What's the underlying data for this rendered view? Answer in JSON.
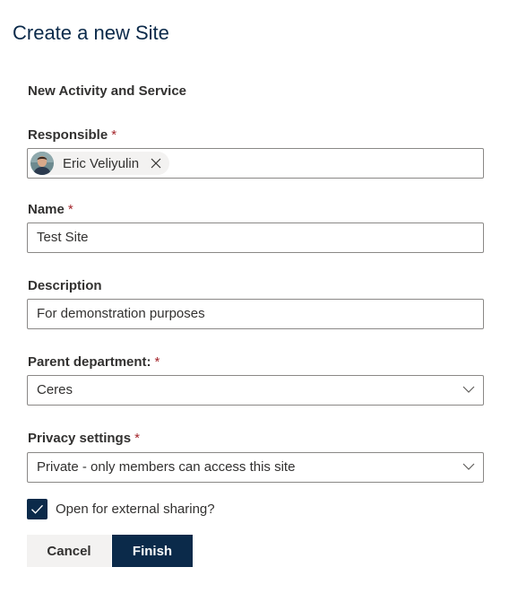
{
  "page": {
    "title": "Create a new Site",
    "section_title": "New Activity and Service"
  },
  "form": {
    "responsible": {
      "label": "Responsible",
      "required_mark": "*",
      "person_name": "Eric Veliyulin"
    },
    "name": {
      "label": "Name",
      "required_mark": "*",
      "value": "Test Site"
    },
    "description": {
      "label": "Description",
      "value": "For demonstration purposes"
    },
    "parent_department": {
      "label": "Parent department:",
      "required_mark": "*",
      "selected": "Ceres"
    },
    "privacy": {
      "label": "Privacy settings",
      "required_mark": "*",
      "selected": "Private - only members can access this site"
    },
    "external_sharing": {
      "label": "Open for external sharing?",
      "checked": true
    }
  },
  "buttons": {
    "cancel": "Cancel",
    "finish": "Finish"
  },
  "colors": {
    "brand": "#0b2a4a",
    "required": "#a4262c",
    "border": "#8a8886",
    "neutral_button": "#f3f2f1"
  },
  "icons": {
    "remove": "close-icon",
    "dropdown": "chevron-down-icon",
    "checkbox": "checkmark-icon"
  }
}
